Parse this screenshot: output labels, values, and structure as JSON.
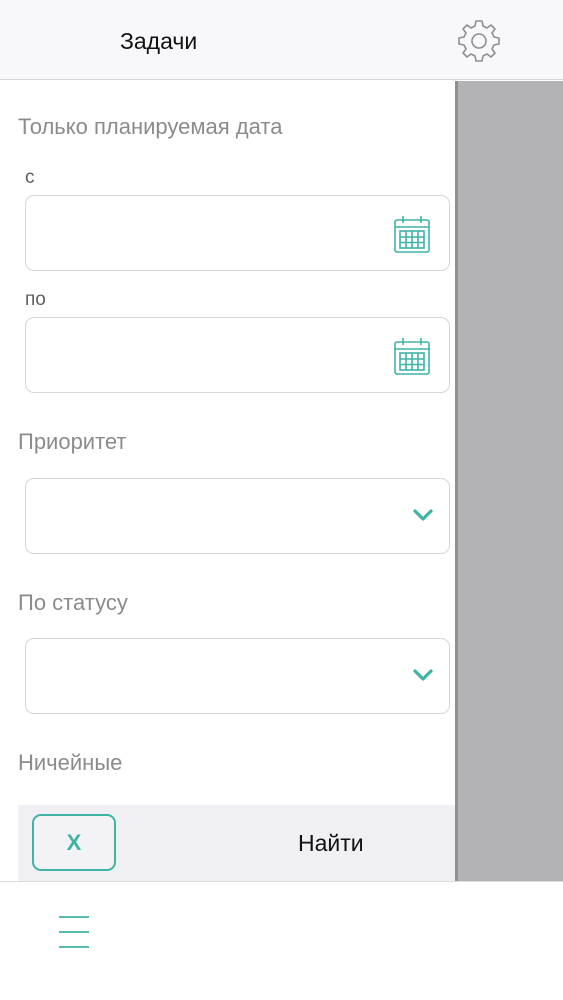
{
  "header": {
    "title": "Задачи",
    "settings_icon": "gear-icon"
  },
  "filters": {
    "planned_date": {
      "title": "Только планируемая дата",
      "from_label": "с",
      "to_label": "по",
      "from_value": "",
      "to_value": "",
      "icon": "calendar-icon"
    },
    "priority": {
      "title": "Приоритет",
      "value": "",
      "icon": "chevron-down-icon"
    },
    "status": {
      "title": "По статусу",
      "value": "",
      "icon": "chevron-down-icon"
    },
    "unassigned": {
      "title": "Ничейные"
    }
  },
  "actions": {
    "clear_label": "X",
    "find_label": "Найти"
  },
  "bottom": {
    "menu_icon": "hamburger-menu-icon"
  },
  "colors": {
    "accent": "#3fb3a6",
    "panel_gray": "#b3b3b5",
    "header_bg": "#f8f8fa"
  }
}
